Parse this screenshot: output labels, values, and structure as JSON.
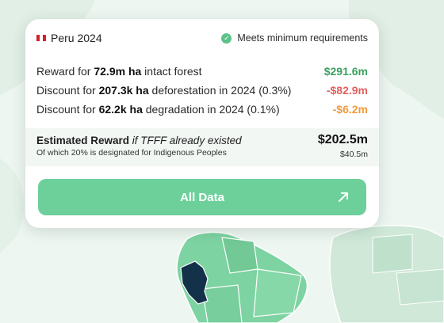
{
  "header": {
    "country": "Peru 2024",
    "status": "Meets minimum requirements"
  },
  "rows": [
    {
      "pre": "Reward for ",
      "strong": "72.9m ha",
      "post": " intact forest",
      "amount": "$291.6m",
      "tone": "green"
    },
    {
      "pre": "Discount for ",
      "strong": "207.3k ha",
      "post": " deforestation in 2024 (0.3%)",
      "amount": "-$82.9m",
      "tone": "red"
    },
    {
      "pre": "Discount for ",
      "strong": "62.2k ha",
      "post": " degradation in 2024 (0.1%)",
      "amount": "-$6.2m",
      "tone": "orange"
    }
  ],
  "estimate": {
    "title_bold": "Estimated Reward",
    "title_italic": " if TFFF already existed",
    "subtitle": "Of which 20% is designated for Indigenous Peoples",
    "value": "$202.5m",
    "sub_value": "$40.5m"
  },
  "button": {
    "label": "All Data"
  },
  "colors": {
    "accent": "#6dd09a",
    "positive": "#3aa15f",
    "negative": "#e15f5f",
    "warning": "#ef9a3a",
    "highlight_country": "#14314a"
  },
  "icons": [
    "peru-flag-icon",
    "check-circle-icon",
    "arrow-up-right-icon"
  ]
}
